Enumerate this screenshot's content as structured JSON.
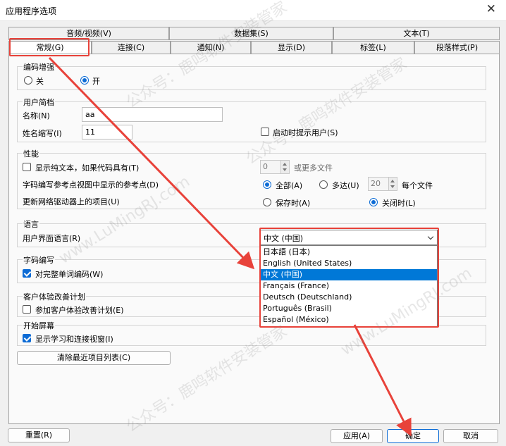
{
  "window": {
    "title": "应用程序选项"
  },
  "tabs": {
    "row1": [
      "音频/视频(V)",
      "数据集(S)",
      "文本(T)"
    ],
    "row2": [
      "常规(G)",
      "连接(C)",
      "通知(N)",
      "显示(D)",
      "标签(L)",
      "段落样式(P)"
    ]
  },
  "encoding_enhance": {
    "title": "编码增强",
    "off": "关",
    "on": "开"
  },
  "user_profile": {
    "title": "用户简档",
    "name_label": "名称(N)",
    "name_value": "aa",
    "initials_label": "姓名缩写(I)",
    "initials_value": "11",
    "prompt_on_startup": "启动时提示用户(S)"
  },
  "performance": {
    "title": "性能",
    "plain_text": "显示纯文本，如果代码具有(T)",
    "ref_points": "字码编写参考点视图中显示的参考点(D)",
    "network_items": "更新网络驱动器上的项目(U)",
    "files_value": "0",
    "or_more_files": "或更多文件",
    "all": "全部(A)",
    "up_to": "多达(U)",
    "up_to_value": "20",
    "per_file": "每个文件",
    "on_save": "保存时(A)",
    "on_close": "关闭时(L)"
  },
  "language": {
    "title": "语言",
    "ui_language_label": "用户界面语言(R)",
    "selected": "中文 (中国)",
    "options": [
      "日本語 (日本)",
      "English (United States)",
      "中文 (中国)",
      "Français (France)",
      "Deutsch (Deutschland)",
      "Português (Brasil)",
      "Español (México)"
    ]
  },
  "coding": {
    "title": "字码编写",
    "whole_word": "对完整单词编码(W)"
  },
  "cx_program": {
    "title": "客户体验改善计划",
    "join": "参加客户体验改善计划(E)"
  },
  "start_screen": {
    "title": "开始屏幕",
    "show_learning": "显示学习和连接视窗(I)"
  },
  "clear_recent": "清除最近项目列表(C)",
  "footer": {
    "reset": "重置(R)",
    "apply": "应用(A)",
    "ok": "确定",
    "cancel": "取消"
  },
  "watermark": [
    "公众号：鹿鸣软件安装管家",
    "www.LuMingRJ.com"
  ],
  "colors": {
    "accent": "#0c6bd5",
    "selection": "#0078d7",
    "annotation": "#e8423a"
  }
}
